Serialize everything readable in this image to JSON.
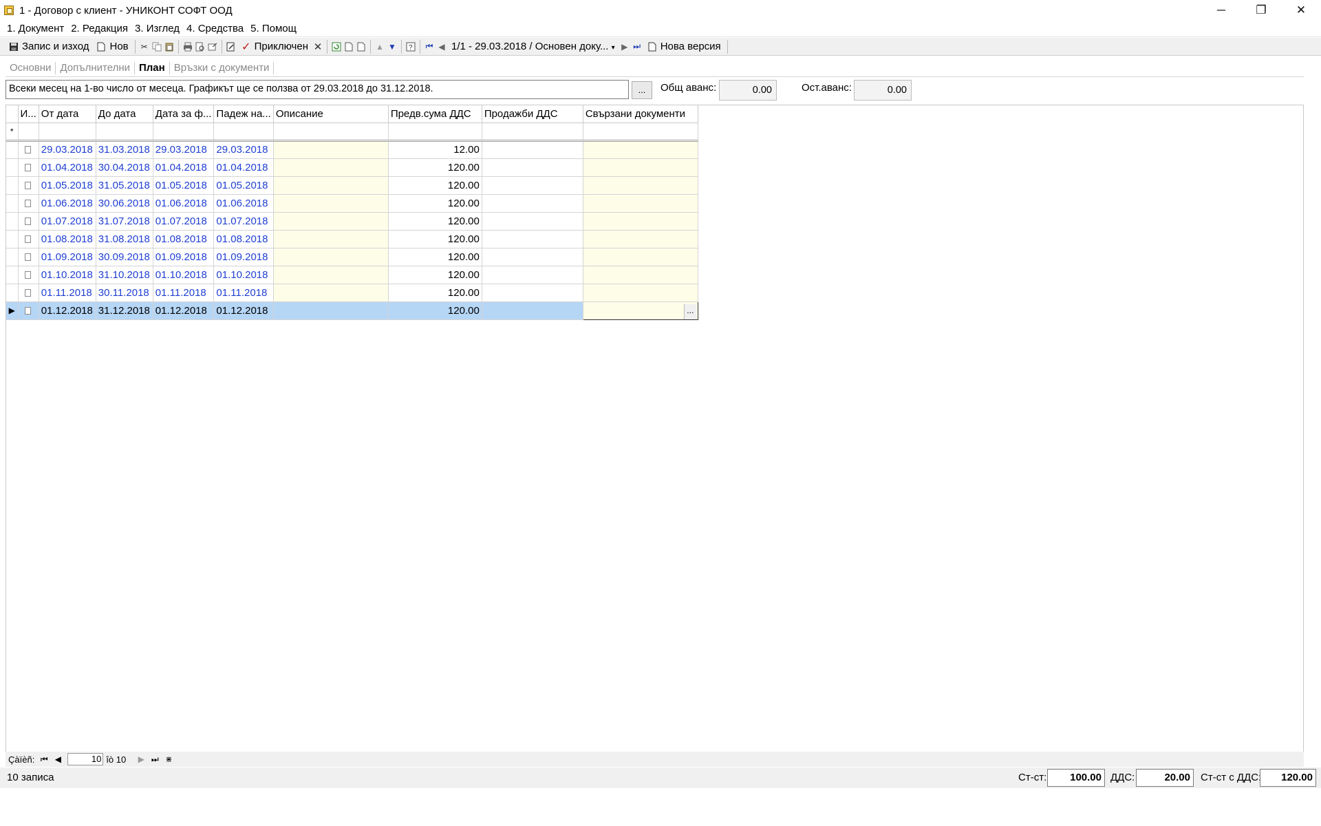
{
  "window": {
    "title": "1 - Договор с клиент - УНИКОНТ СОФТ ООД",
    "min_glyph": "─",
    "max_glyph": "❐",
    "close_glyph": "✕"
  },
  "menu": [
    "1. Документ",
    "2. Редакция",
    "3. Изглед",
    "4. Средства",
    "5. Помощ"
  ],
  "toolbar": {
    "save_exit": "Запис и изход",
    "new": "Нов",
    "close_doc": "Приключен",
    "nav_position": "1/1 - 29.03.2018 / Основен доку...",
    "new_version": "Нова версия"
  },
  "tabs": [
    {
      "label": "Основни",
      "active": false
    },
    {
      "label": "Допълнителни",
      "active": false
    },
    {
      "label": "План",
      "active": true
    },
    {
      "label": "Връзки с документи",
      "active": false
    }
  ],
  "schedule": {
    "text": "Всеки месец на 1-во число от месеца. Графикът ще се ползва от 29.03.2018 до 31.12.2018.",
    "ellipsis": "...",
    "total_advance_label": "Общ аванс:",
    "total_advance_value": "0.00",
    "remaining_advance_label": "Ост.аванс:",
    "remaining_advance_value": "0.00"
  },
  "grid": {
    "columns": [
      "И...",
      "От дата",
      "До дата",
      "Дата за ф...",
      "Падеж на...",
      "Описание",
      "Предв.сума ДДС",
      "Продажби ДДС",
      "Свързани документи"
    ],
    "new_row_marker": "*",
    "rows": [
      {
        "from": "29.03.2018",
        "to": "31.03.2018",
        "invoice": "29.03.2018",
        "due": "29.03.2018",
        "desc": "",
        "amount": "12.00",
        "sales": "",
        "linked": ""
      },
      {
        "from": "01.04.2018",
        "to": "30.04.2018",
        "invoice": "01.04.2018",
        "due": "01.04.2018",
        "desc": "",
        "amount": "120.00",
        "sales": "",
        "linked": ""
      },
      {
        "from": "01.05.2018",
        "to": "31.05.2018",
        "invoice": "01.05.2018",
        "due": "01.05.2018",
        "desc": "",
        "amount": "120.00",
        "sales": "",
        "linked": ""
      },
      {
        "from": "01.06.2018",
        "to": "30.06.2018",
        "invoice": "01.06.2018",
        "due": "01.06.2018",
        "desc": "",
        "amount": "120.00",
        "sales": "",
        "linked": ""
      },
      {
        "from": "01.07.2018",
        "to": "31.07.2018",
        "invoice": "01.07.2018",
        "due": "01.07.2018",
        "desc": "",
        "amount": "120.00",
        "sales": "",
        "linked": ""
      },
      {
        "from": "01.08.2018",
        "to": "31.08.2018",
        "invoice": "01.08.2018",
        "due": "01.08.2018",
        "desc": "",
        "amount": "120.00",
        "sales": "",
        "linked": ""
      },
      {
        "from": "01.09.2018",
        "to": "30.09.2018",
        "invoice": "01.09.2018",
        "due": "01.09.2018",
        "desc": "",
        "amount": "120.00",
        "sales": "",
        "linked": ""
      },
      {
        "from": "01.10.2018",
        "to": "31.10.2018",
        "invoice": "01.10.2018",
        "due": "01.10.2018",
        "desc": "",
        "amount": "120.00",
        "sales": "",
        "linked": ""
      },
      {
        "from": "01.11.2018",
        "to": "30.11.2018",
        "invoice": "01.11.2018",
        "due": "01.11.2018",
        "desc": "",
        "amount": "120.00",
        "sales": "",
        "linked": ""
      },
      {
        "from": "01.12.2018",
        "to": "31.12.2018",
        "invoice": "01.12.2018",
        "due": "01.12.2018",
        "desc": "",
        "amount": "120.00",
        "sales": "",
        "linked": ""
      }
    ],
    "selected_row_index": 9
  },
  "navigator": {
    "label": "Çàïèñ:",
    "current": "10",
    "of_text": "îò 10"
  },
  "status": {
    "records": "10 записа",
    "net_label": "Ст-ст:",
    "net_value": "100.00",
    "vat_label": "ДДС:",
    "vat_value": "20.00",
    "gross_label": "Ст-ст с ДДС:",
    "gross_value": "120.00"
  }
}
